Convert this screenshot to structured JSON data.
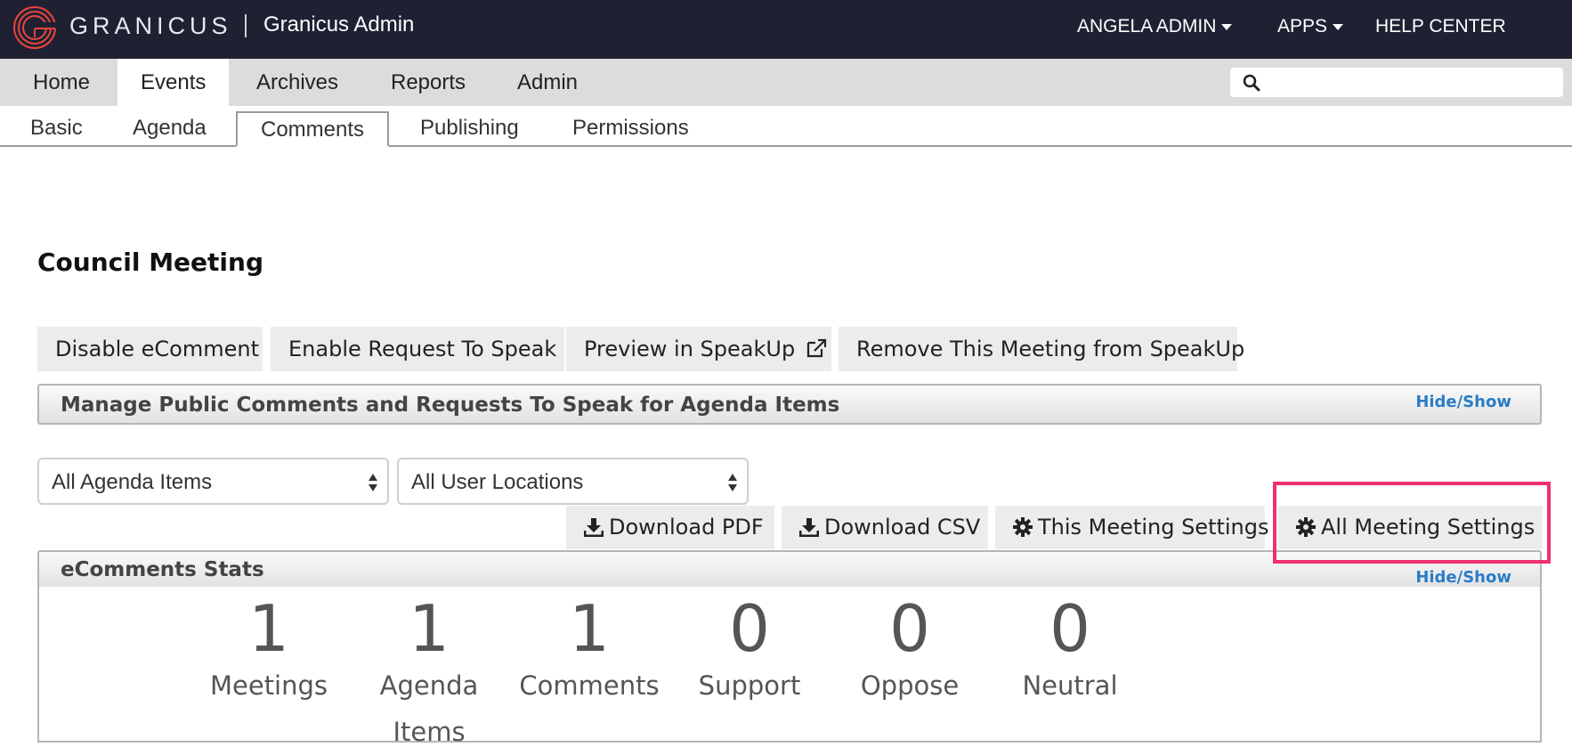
{
  "header": {
    "brand": "GRANICUS",
    "app_name": "Granicus Admin",
    "user_menu": "ANGELA ADMIN",
    "apps_menu": "APPS",
    "help_center": "HELP CENTER"
  },
  "main_nav": {
    "tabs": [
      {
        "label": "Home"
      },
      {
        "label": "Events"
      },
      {
        "label": "Archives"
      },
      {
        "label": "Reports"
      },
      {
        "label": "Admin"
      }
    ],
    "active": "Events",
    "search": {
      "value": "",
      "placeholder": ""
    }
  },
  "sub_nav": {
    "tabs": [
      {
        "label": "Basic"
      },
      {
        "label": "Agenda"
      },
      {
        "label": "Comments"
      },
      {
        "label": "Publishing"
      },
      {
        "label": "Permissions"
      }
    ],
    "active": "Comments"
  },
  "page": {
    "title": "Council Meeting",
    "actions": [
      {
        "label": "Disable eComment"
      },
      {
        "label": "Enable Request To Speak"
      },
      {
        "label": "Preview in SpeakUp"
      },
      {
        "label": "Remove This Meeting from SpeakUp"
      }
    ],
    "manage_panel": {
      "title": "Manage Public Comments and Requests To Speak for Agenda Items",
      "toggle": "Hide/Show"
    },
    "filters": {
      "agenda_items": "All Agenda Items",
      "user_locations": "All User Locations"
    },
    "tools": [
      {
        "label": "Download PDF",
        "icon": "download-icon"
      },
      {
        "label": "Download CSV",
        "icon": "download-icon"
      },
      {
        "label": "This Meeting Settings",
        "icon": "gear-icon"
      },
      {
        "label": "All Meeting Settings",
        "icon": "gear-icon"
      }
    ],
    "highlight_color": "#f0306e",
    "stats_panel": {
      "title": "eComments Stats",
      "toggle": "Hide/Show",
      "stats": [
        {
          "value": "1",
          "label": "Meetings"
        },
        {
          "value": "1",
          "label": "Agenda Items"
        },
        {
          "value": "1",
          "label": "Comments"
        },
        {
          "value": "0",
          "label": "Support"
        },
        {
          "value": "0",
          "label": "Oppose"
        },
        {
          "value": "0",
          "label": "Neutral"
        }
      ]
    }
  },
  "colors": {
    "topbar": "#1f2133",
    "link": "#2a7cc7",
    "brand_red": "#e8453c"
  }
}
